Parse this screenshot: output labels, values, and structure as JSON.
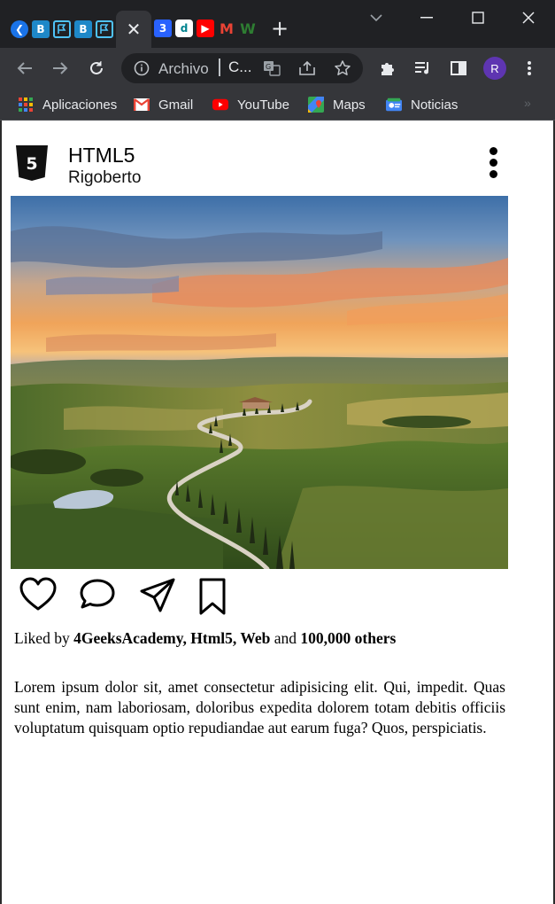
{
  "browser": {
    "tab_close_glyph": "✕",
    "new_tab_glyph": "+",
    "omnibox": {
      "security_label": "Archivo",
      "url_text": "C..."
    },
    "avatar_initial": "R",
    "bookmarks": [
      {
        "label": "Aplicaciones",
        "icon": "apps-grid-icon"
      },
      {
        "label": "Gmail",
        "icon": "gmail-icon"
      },
      {
        "label": "YouTube",
        "icon": "youtube-icon"
      },
      {
        "label": "Maps",
        "icon": "maps-icon"
      },
      {
        "label": "Noticias",
        "icon": "news-icon"
      }
    ],
    "colors": {
      "frame": "#202124",
      "toolbar": "#35363a",
      "text": "#e8eaed"
    }
  },
  "post": {
    "title": "HTML5",
    "author": "Rigoberto",
    "logo_digit": "5",
    "likes": {
      "prefix": "Liked by",
      "names": "4GeeksAcademy, Html5, Web",
      "joiner": "and",
      "others": "100,000 others"
    },
    "body": "Lorem ipsum dolor sit, amet consectetur adipisicing elit. Qui, impedit. Quas sunt enim, nam laboriosam, doloribus expedita dolorem totam debitis officiis voluptatum quisquam optio repudiandae aut earum fuga? Quos, perspiciatis.",
    "actions": [
      "heart-icon",
      "comment-icon",
      "send-icon",
      "bookmark-icon"
    ]
  }
}
